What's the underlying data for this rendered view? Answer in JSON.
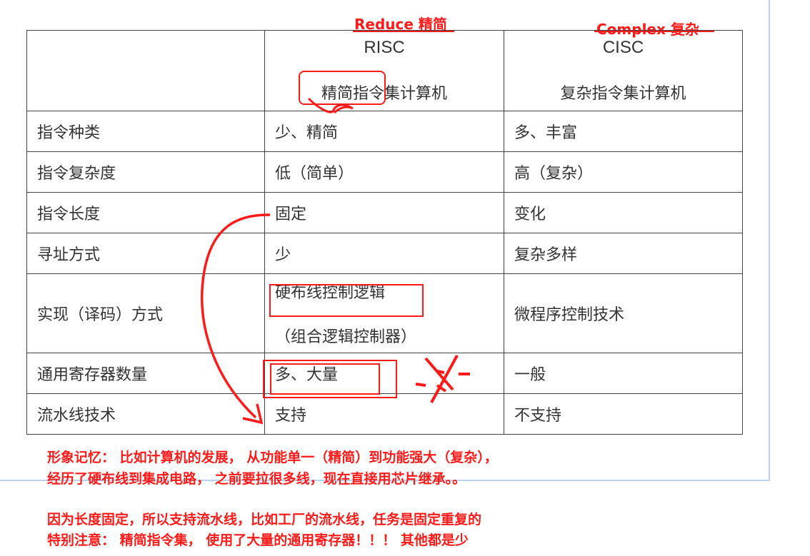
{
  "labels": {
    "reduce": "Reduce 精简",
    "complex": "Complex 复杂"
  },
  "table": {
    "header": {
      "risc_code": "RISC",
      "risc_full": "精简指令集计算机",
      "cisc_code": "CISC",
      "cisc_full": "复杂指令集计算机"
    },
    "rows": [
      {
        "attr": "指令种类",
        "risc": "少、精简",
        "cisc": "多、丰富"
      },
      {
        "attr": "指令复杂度",
        "risc": "低（简单）",
        "cisc": "高（复杂）"
      },
      {
        "attr": "指令长度",
        "risc": "固定",
        "cisc": "变化"
      },
      {
        "attr": "寻址方式",
        "risc": "少",
        "cisc": "复杂多样"
      },
      {
        "attr": "实现（译码）方式",
        "risc_line1": "硬布线控制逻辑",
        "risc_line2": "（组合逻辑控制器）",
        "cisc": "微程序控制技术"
      },
      {
        "attr": "通用寄存器数量",
        "risc": "多、大量",
        "cisc": "一般"
      },
      {
        "attr": "流水线技术",
        "risc": "支持",
        "cisc": "不支持"
      }
    ]
  },
  "notes": {
    "n1": "形象记忆： 比如计算机的发展， 从功能单一（精简）到功能强大（复杂），",
    "n2": "经历了硬布线到集成电路， 之前要拉很多线，现在直接用芯片继承。。",
    "n3": "因为长度固定，所以支持流水线，比如工厂的流水线，任务是固定重复的",
    "n4": "特别注意： 精简指令集， 使用了大量的通用寄存器！！！ 其他都是少"
  },
  "colors": {
    "annotation_red": "#ff1a1a",
    "frame_blue": "#b9d3ef",
    "table_border": "#444444"
  }
}
